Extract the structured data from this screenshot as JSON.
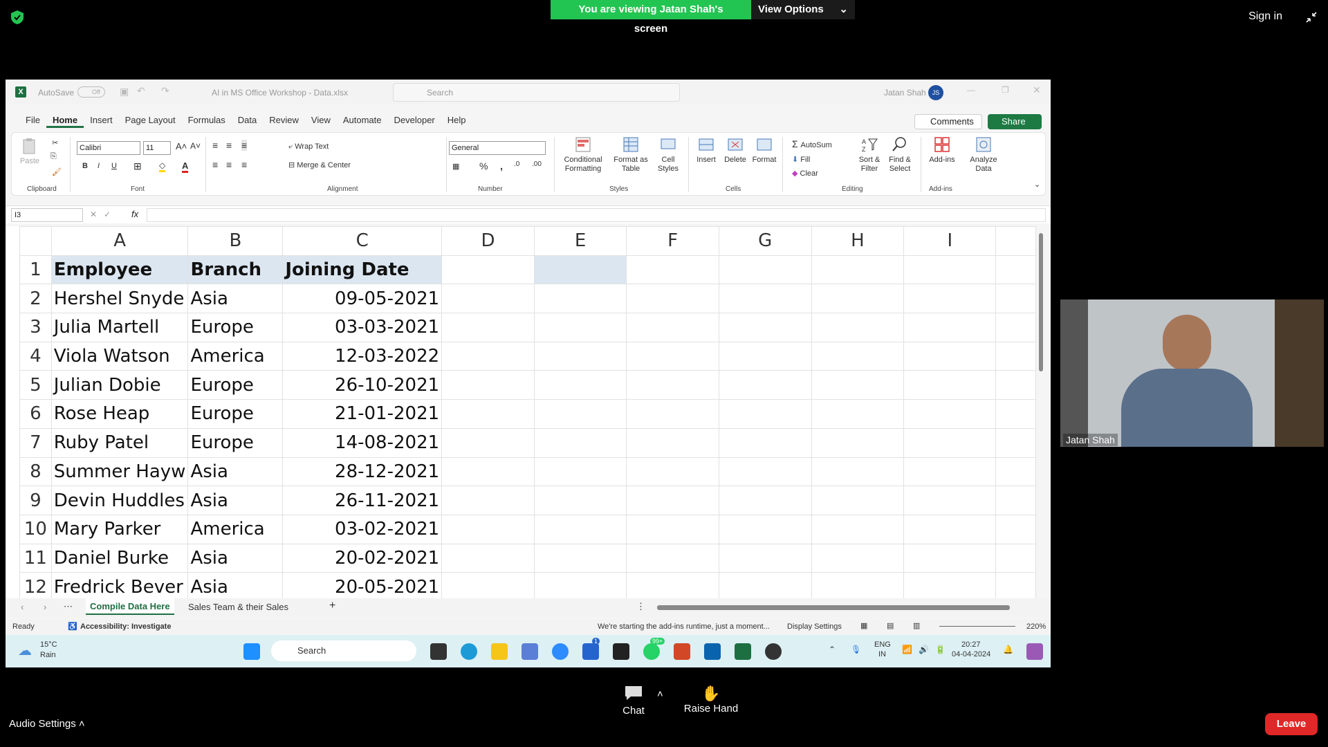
{
  "zoom": {
    "banner_text": "You are viewing Jatan Shah's screen",
    "view_options": "View Options",
    "sign_in": "Sign in",
    "audio_settings": "Audio Settings",
    "chat": "Chat",
    "raise_hand": "Raise Hand",
    "leave": "Leave",
    "participant_name": "Jatan Shah"
  },
  "excel": {
    "autosave": "AutoSave",
    "autosave_state": "Off",
    "doc_title": "AI in MS Office Workshop - Data.xlsx",
    "search_placeholder": "Search",
    "user_name": "Jatan Shah",
    "user_initials": "JS",
    "menu": [
      "File",
      "Home",
      "Insert",
      "Page Layout",
      "Formulas",
      "Data",
      "Review",
      "View",
      "Automate",
      "Developer",
      "Help"
    ],
    "comments": "Comments",
    "share": "Share",
    "ribbon": {
      "paste": "Paste",
      "clipboard": "Clipboard",
      "font_name": "Calibri",
      "font_size": "11",
      "font": "Font",
      "wrap_text": "Wrap Text",
      "merge_center": "Merge & Center",
      "alignment": "Alignment",
      "number_format": "General",
      "number": "Number",
      "conditional": "Conditional",
      "formatting": "Formatting",
      "format_as": "Format as",
      "table": "Table",
      "cell": "Cell",
      "styles_btn": "Styles",
      "styles": "Styles",
      "insert": "Insert",
      "delete": "Delete",
      "format": "Format",
      "cells": "Cells",
      "autosum": "AutoSum",
      "fill": "Fill",
      "clear": "Clear",
      "sort": "Sort &",
      "filter": "Filter",
      "find": "Find &",
      "select": "Select",
      "editing": "Editing",
      "addins": "Add-ins",
      "addins_grp": "Add-ins",
      "analyze": "Analyze",
      "data": "Data"
    },
    "name_box": "I3",
    "columns": [
      "A",
      "B",
      "C",
      "D",
      "E",
      "F",
      "G",
      "H",
      "I"
    ],
    "headers": [
      "Employee",
      "Branch",
      "Joining Date"
    ],
    "rows": [
      [
        "Hershel Snyde",
        "Asia",
        "09-05-2021"
      ],
      [
        "Julia Martell",
        "Europe",
        "03-03-2021"
      ],
      [
        "Viola Watson",
        "America",
        "12-03-2022"
      ],
      [
        "Julian Dobie",
        "Europe",
        "26-10-2021"
      ],
      [
        "Rose Heap",
        "Europe",
        "21-01-2021"
      ],
      [
        "Ruby Patel",
        "Europe",
        "14-08-2021"
      ],
      [
        "Summer Hayw",
        "Asia",
        "28-12-2021"
      ],
      [
        "Devin Huddles",
        "Asia",
        "26-11-2021"
      ],
      [
        "Mary Parker",
        "America",
        "03-02-2021"
      ],
      [
        "Daniel Burke",
        "Asia",
        "20-02-2021"
      ],
      [
        "Fredrick Bever",
        "Asia",
        "20-05-2021"
      ]
    ],
    "row_numbers": [
      "1",
      "2",
      "3",
      "4",
      "5",
      "6",
      "7",
      "8",
      "9",
      "10",
      "11",
      "12"
    ],
    "sheet_tabs": [
      "Compile Data Here",
      "Sales Team & their Sales"
    ],
    "status_ready": "Ready",
    "accessibility": "Accessibility: Investigate",
    "addins_msg": "We're starting the add-ins runtime, just a moment...",
    "display_settings": "Display Settings",
    "zoom_level": "220%"
  },
  "taskbar": {
    "temp": "15°C",
    "weather": "Rain",
    "search": "Search",
    "lang1": "ENG",
    "lang2": "IN",
    "time": "20:27",
    "date": "04-04-2024",
    "badge_whatsapp": "99+",
    "badge_todo": "1"
  }
}
